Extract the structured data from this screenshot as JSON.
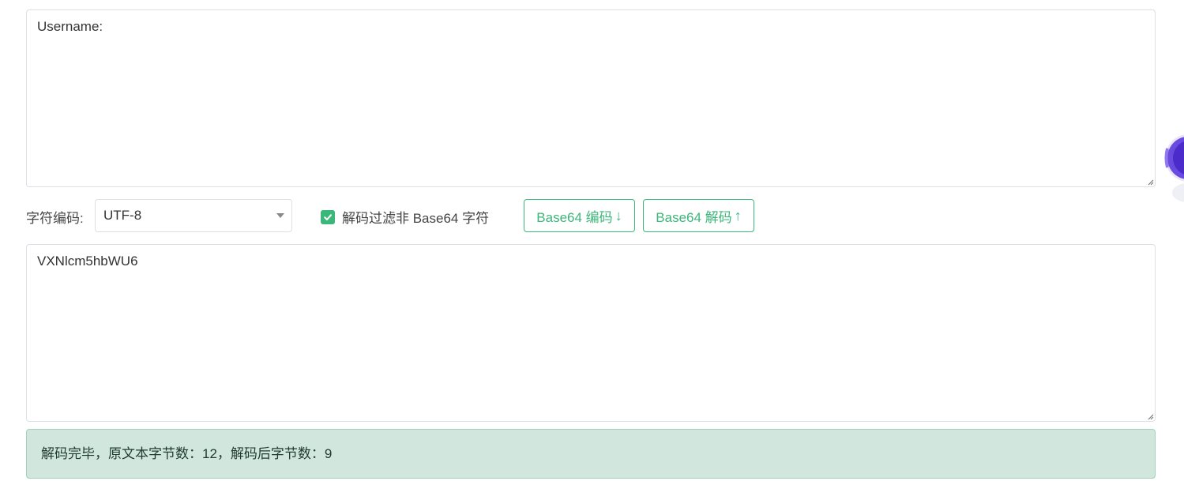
{
  "input": {
    "value": "Username:"
  },
  "toolbar": {
    "encoding_label": "字符编码:",
    "encoding_selected": "UTF-8",
    "filter_checkbox_label": "解码过滤非 Base64 字符",
    "filter_checked": true,
    "encode_button_label": "Base64 编码",
    "encode_button_arrow": "↓",
    "decode_button_label": "Base64 解码",
    "decode_button_arrow": "↑"
  },
  "output": {
    "value": "VXNlcm5hbWU6"
  },
  "status": {
    "message": "解码完毕，原文本字节数：12，解码后字节数：9"
  },
  "colors": {
    "accent": "#3cb77a",
    "alert_bg": "#d1e7dd",
    "floating_widget": "#5b3fd6"
  },
  "icons": {
    "checkbox": "check-icon",
    "select_caret": "caret-down-icon",
    "floating_widget": "assistant-robot-icon"
  }
}
